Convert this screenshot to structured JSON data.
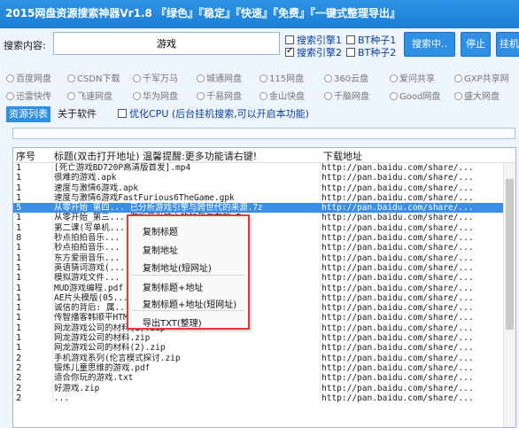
{
  "window": {
    "title": "2015网盘资源搜索神器Vr1.8 『绿色』『稳定』『快速』『免费』『一键式整理导出』"
  },
  "search": {
    "label": "搜索内容:",
    "value": "游戏",
    "engine1_label": "搜索引擎1",
    "engine2_label": "搜索引擎2",
    "engine1_checked": false,
    "engine2_checked": true,
    "bt1_label": "BT种子1",
    "bt2_label": "BT种子2",
    "bt1_checked": false,
    "bt2_checked": false,
    "search_button": "搜索中..",
    "stop_button": "停止",
    "extra_button": "挂机"
  },
  "sources": {
    "row1": [
      "百度网盘",
      "CSDN下载",
      "千军万马",
      "城通网盘",
      "115网盘",
      "360云盘",
      "爱问共享",
      "GXP共享网"
    ],
    "row2": [
      "迅雷快传",
      "飞速网盘",
      "华为网盘",
      "千易网盘",
      "金山快盘",
      "千脑网盘",
      "Good网盘",
      "盛大网盘"
    ]
  },
  "tabs": {
    "list": "资源列表",
    "about": "关于软件"
  },
  "cpu_option": {
    "label": "优化CPU (后台挂机搜索,可以开启本功能)",
    "checked": false
  },
  "progress": {
    "fraction": 0.0
  },
  "table": {
    "headers": {
      "num": "序号",
      "title": "标题(双击打开地址) 温馨提醒:更多功能请右键!",
      "url": "下载地址"
    },
    "selected_index": 4,
    "rows": [
      {
        "num": "1",
        "title": "[死亡游戏BD720P高清版首发].mp4",
        "url": "http://pan.baidu.com/share/..."
      },
      {
        "num": "1",
        "title": "很难的游戏.apk",
        "url": "http://pan.baidu.com/share/..."
      },
      {
        "num": "1",
        "title": "速度与激情6游戏.apk",
        "url": "http://pan.baidu.com/share/..."
      },
      {
        "num": "1",
        "title": "速度与激情6游戏FastFurious6TheGame.gpk",
        "url": "http://pan.baidu.com/share/..."
      },
      {
        "num": "5",
        "title": "从零开始_第四... 已分析游戏引擎与跨世代的来源.7z",
        "url": "http://pan.baidu.com/share/..."
      },
      {
        "num": "1",
        "title": "从零开始_第三... 游戏开发核心的加载与存放.7z",
        "url": "http://pan.baidu.com/share/..."
      },
      {
        "num": "1",
        "title": "第二课(写单机...",
        "url": "http://pan.baidu.com/share/..."
      },
      {
        "num": "8",
        "title": "秒点拍拍音乐...",
        "url": "http://pan.baidu.com/share/..."
      },
      {
        "num": "1",
        "title": "秒点拍拍音乐...",
        "url": "http://pan.baidu.com/share/..."
      },
      {
        "num": "1",
        "title": "东方爱丽音乐...",
        "url": "http://pan.baidu.com/share/..."
      },
      {
        "num": "1",
        "title": "英语猜词游戏(...",
        "url": "http://pan.baidu.com/share/..."
      },
      {
        "num": "1",
        "title": "模拟游戏文件...",
        "url": "http://pan.baidu.com/share/..."
      },
      {
        "num": "1",
        "title": "MUD游戏编程.pdf",
        "url": "http://pan.baidu.com/share/..."
      },
      {
        "num": "1",
        "title": "AE片头模版(05... 视视频制...",
        "url": "http://pan.baidu.com/share/..."
      },
      {
        "num": "1",
        "title": "诚信的背后: 属... 弗兰...",
        "url": "http://pan.baidu.com/share/..."
      },
      {
        "num": "1",
        "title": "传智播客韩顺平HTML5网页游戏_坦克大战.ppt",
        "url": "http://pan.baidu.com/share/..."
      },
      {
        "num": "1",
        "title": "网龙游戏公司的材料(1).zip",
        "url": "http://pan.baidu.com/share/..."
      },
      {
        "num": "1",
        "title": "网龙游戏公司的材料.zip",
        "url": "http://pan.baidu.com/share/..."
      },
      {
        "num": "1",
        "title": "网龙游戏公司的材料(2).zip",
        "url": "http://pan.baidu.com/share/..."
      },
      {
        "num": "2",
        "title": "手机游戏系列(伦言模式探讨.zip",
        "url": "http://pan.baidu.com/share/..."
      },
      {
        "num": "2",
        "title": "锻炼儿童思维的游戏.pdf",
        "url": "http://pan.baidu.com/share/..."
      },
      {
        "num": "2",
        "title": "适合你玩的游戏.txt",
        "url": "http://pan.baidu.com/share/..."
      },
      {
        "num": "2",
        "title": "好游戏.zip",
        "url": "http://pan.baidu.com/share/..."
      },
      {
        "num": "2",
        "title": "...",
        "url": "http://pan.baidu.com/share/..."
      }
    ]
  },
  "context_menu": {
    "items": [
      "复制标题",
      "复制地址",
      "复制地址(短网址)",
      "复制标题+地址",
      "复制标题+地址(短网址)",
      "导出TXT(整理)"
    ]
  }
}
